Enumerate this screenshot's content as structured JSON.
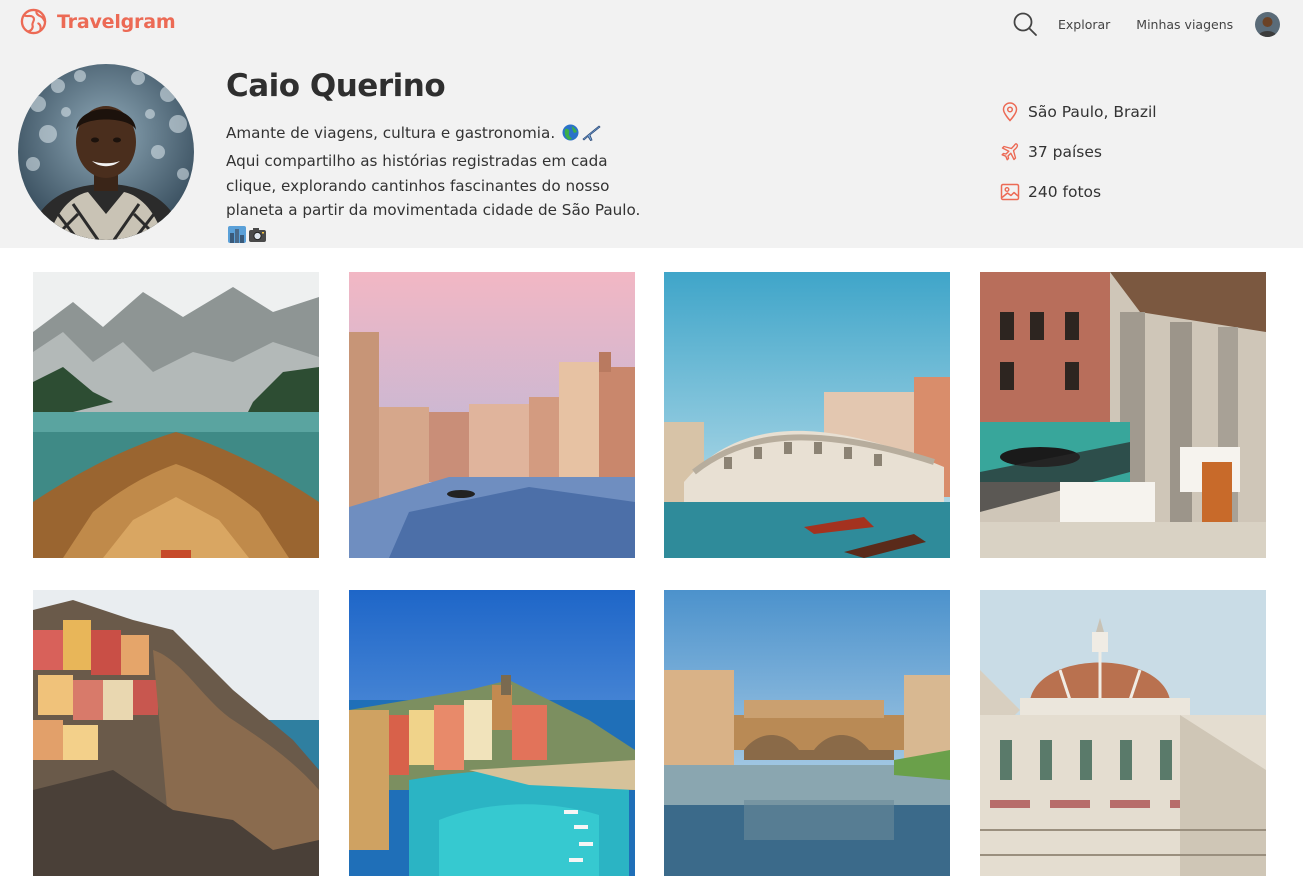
{
  "app": {
    "name": "Travelgram",
    "brand_color": "#ec6a55"
  },
  "nav": {
    "search_icon": "search-icon",
    "links": [
      "Explorar",
      "Minhas viagens"
    ]
  },
  "profile": {
    "name": "Caio Querino",
    "bio_line1": "Amante de viagens, cultura e gastronomia.",
    "bio_line2": "Aqui compartilho as histórias registradas em cada clique, explorando cantinhos fascinantes do nosso planeta a partir da movimentada cidade de São Paulo.",
    "stats": {
      "location": "São Paulo, Brazil",
      "countries": "37 países",
      "photos": "240 fotos"
    }
  },
  "gallery": {
    "photos": [
      {
        "subject": "lake-boat"
      },
      {
        "subject": "venice-canal-sunset"
      },
      {
        "subject": "rialto-bridge"
      },
      {
        "subject": "venice-cafe-terrace"
      },
      {
        "subject": "manarola-cliff"
      },
      {
        "subject": "vernazza-harbor"
      },
      {
        "subject": "ponte-vecchio"
      },
      {
        "subject": "florence-duomo"
      }
    ]
  }
}
